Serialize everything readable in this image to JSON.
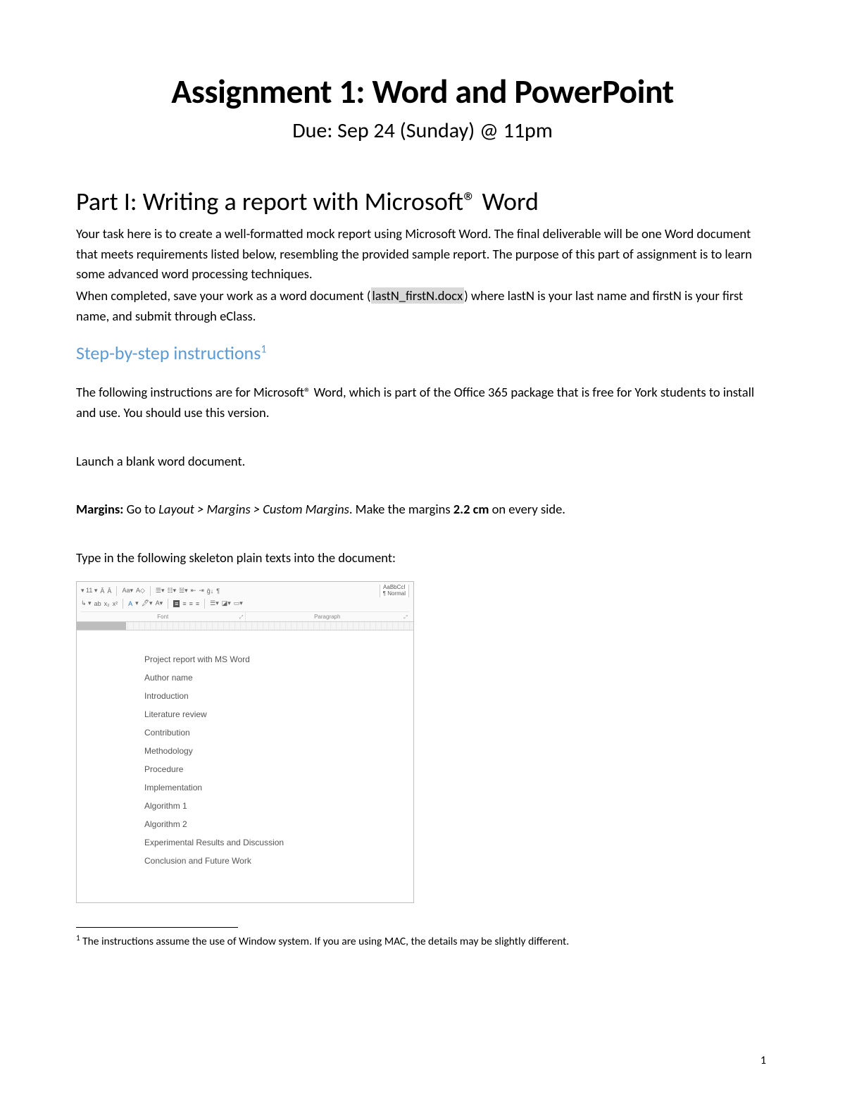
{
  "title": "Assignment 1: Word and PowerPoint",
  "due": "Due: Sep 24 (Sunday) @ 11pm",
  "part1": {
    "heading": "Part I: Writing a report with Microsoft® Word",
    "p1a": "Your task here is to create a well-formatted mock report using Microsoft Word. The final deliverable will be one Word document that meets requirements listed below, resembling the provided sample report. The purpose of this part of assignment is to learn some advanced word processing techniques.",
    "p1b_pre": "When completed, save your work as a word document (",
    "p1b_file": "lastN_firstN.docx",
    "p1b_post": ") where lastN is your last name and firstN is your first name, and submit through eClass."
  },
  "steps": {
    "heading": "Step-by-step instructions",
    "heading_sup": "1",
    "p1": "The following instructions are for Microsoft® Word, which is part of the Office 365 package that is free for York students to install and use. You should use this version.",
    "p2": "Launch a blank word document.",
    "margins_label": "Margins: ",
    "margins_goto": "Go to ",
    "margins_path": "Layout > Margins > Custom Margins",
    "margins_rest": ". Make the margins ",
    "margins_val": "2.2 cm",
    "margins_tail": " on every side.",
    "p4": "Type in the following skeleton plain texts into the document:"
  },
  "word_ribbon": {
    "font_size": "11",
    "group_font": "Font",
    "group_para": "Paragraph",
    "styles_sample": "AaBbCcI",
    "styles_normal": "¶ Normal"
  },
  "skeleton_lines": [
    "Project report with MS Word",
    "Author name",
    "Introduction",
    "Literature review",
    "Contribution",
    "Methodology",
    "Procedure",
    "Implementation",
    "Algorithm 1",
    "Algorithm 2",
    "Experimental Results and Discussion",
    "Conclusion and Future Work"
  ],
  "footnote": {
    "num": "1",
    "text": " The instructions assume the use of Window system. If you are using MAC, the details may be slightly different."
  },
  "page_number": "1"
}
